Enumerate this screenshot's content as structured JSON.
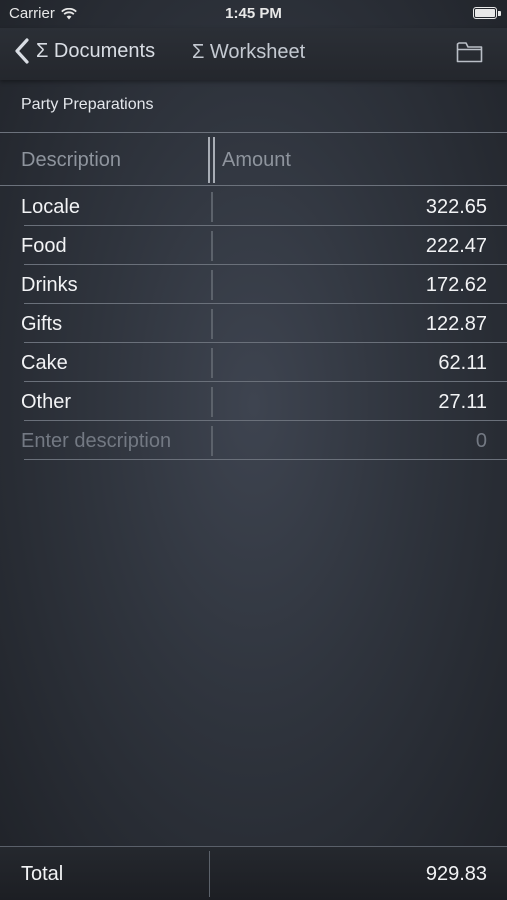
{
  "status_bar": {
    "carrier": "Carrier",
    "time": "1:45 PM"
  },
  "nav": {
    "back_label": "Σ Documents",
    "title": "Σ Worksheet"
  },
  "document": {
    "title": "Party Preparations"
  },
  "table": {
    "columns": [
      "Description",
      "Amount"
    ],
    "rows": [
      {
        "description": "Locale",
        "amount": "322.65"
      },
      {
        "description": "Food",
        "amount": "222.47"
      },
      {
        "description": "Drinks",
        "amount": "172.62"
      },
      {
        "description": "Gifts",
        "amount": "122.87"
      },
      {
        "description": "Cake",
        "amount": "62.11"
      },
      {
        "description": "Other",
        "amount": "27.11"
      }
    ],
    "new_row": {
      "description_placeholder": "Enter description",
      "amount_placeholder": "0"
    }
  },
  "footer": {
    "total_label": "Total",
    "total_value": "929.83"
  },
  "icons": {
    "back": "chevron-left-icon",
    "folder": "folder-icon",
    "wifi": "wifi-icon",
    "battery": "battery-icon"
  }
}
